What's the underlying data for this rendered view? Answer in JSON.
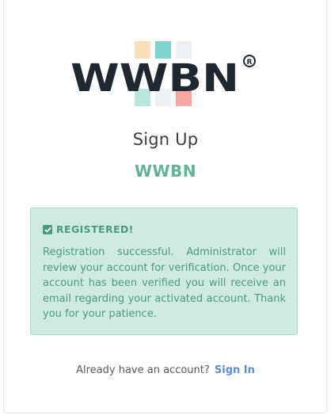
{
  "logo": {
    "text": "WWBN",
    "mark": "®"
  },
  "page": {
    "heading": "Sign Up",
    "brand": "WWBN"
  },
  "alert": {
    "title": "REGISTERED!",
    "message": "Registration successful. Administrator will review your account for verification. Once your account has been verified you will receive an email regarding your activated account. Thank you for your patience."
  },
  "footer": {
    "prompt": "Already have an account?",
    "signin_label": "Sign In"
  },
  "colors": {
    "brand_green": "#5fb39b",
    "alert_bg": "#cfeae2",
    "link_blue": "#5b8ed6",
    "logo_dark": "#1f2730"
  }
}
